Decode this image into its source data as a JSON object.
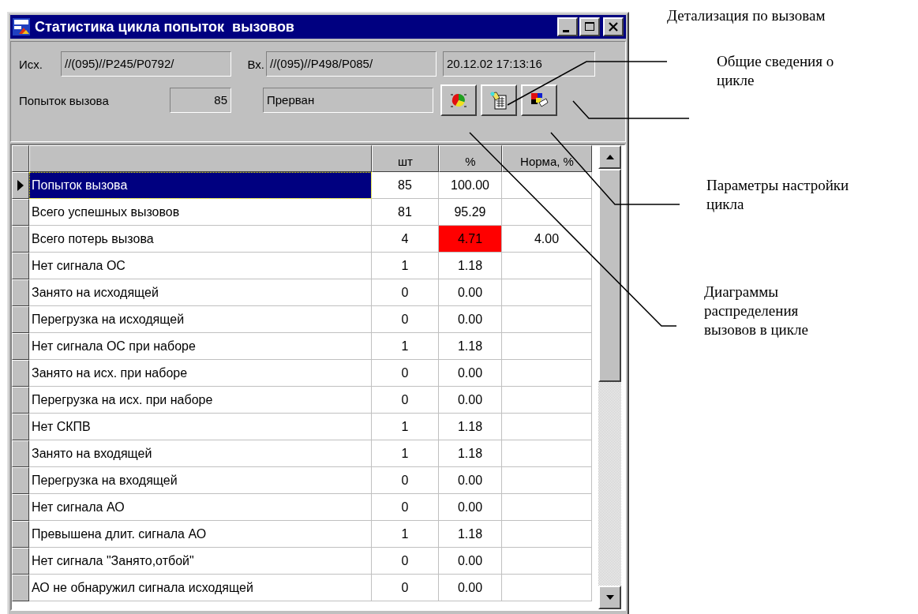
{
  "window": {
    "title": "Статистика цикла попыток  вызовов"
  },
  "header": {
    "outgoing_label": "Исх.",
    "outgoing": "//(095)//P245/P0792/",
    "incoming_label": "Вх.",
    "incoming": "//(095)//P498/P085/",
    "datetime": "20.12.02 17:13:16",
    "attempts_label": "Попыток вызова",
    "attempts": "85",
    "status": "Прерван"
  },
  "table": {
    "columns": [
      "шт",
      "%",
      "Норма, %"
    ],
    "rows": [
      {
        "name": "Попыток вызова",
        "count": "85",
        "percent": "100.00",
        "selected": true,
        "exceeded": false
      },
      {
        "name": "Всего успешных вызовов",
        "count": "81",
        "percent": "95.29",
        "selected": false,
        "exceeded": false
      },
      {
        "name": "Всего потерь вызова",
        "count": "4",
        "percent": "4.71",
        "norm": "4.00",
        "selected": false,
        "exceeded": true
      },
      {
        "name": "Нет сигнала ОС",
        "count": "1",
        "percent": "1.18",
        "selected": false,
        "exceeded": false
      },
      {
        "name": "Занято на исходящей",
        "count": "0",
        "percent": "0.00",
        "selected": false,
        "exceeded": false
      },
      {
        "name": "Перегрузка на исходящей",
        "count": "0",
        "percent": "0.00",
        "selected": false,
        "exceeded": false
      },
      {
        "name": "Нет сигнала ОС при наборе",
        "count": "1",
        "percent": "1.18",
        "selected": false,
        "exceeded": false
      },
      {
        "name": "Занято на исх. при наборе",
        "count": "0",
        "percent": "0.00",
        "selected": false,
        "exceeded": false
      },
      {
        "name": "Перегрузка на исх. при наборе",
        "count": "0",
        "percent": "0.00",
        "selected": false,
        "exceeded": false
      },
      {
        "name": "Нет СКПВ",
        "count": "1",
        "percent": "1.18",
        "selected": false,
        "exceeded": false
      },
      {
        "name": "Занято на входящей",
        "count": "1",
        "percent": "1.18",
        "selected": false,
        "exceeded": false
      },
      {
        "name": "Перегрузка на входящей",
        "count": "0",
        "percent": "0.00",
        "selected": false,
        "exceeded": false
      },
      {
        "name": "Нет сигнала АО",
        "count": "0",
        "percent": "0.00",
        "selected": false,
        "exceeded": false
      },
      {
        "name": "Превышена длит. сигнала АО",
        "count": "1",
        "percent": "1.18",
        "selected": false,
        "exceeded": false
      },
      {
        "name": "Нет сигнала \"Занято,отбой\"",
        "count": "0",
        "percent": "0.00",
        "selected": false,
        "exceeded": false
      },
      {
        "name": "АО не обнаружил сигнала исходящей",
        "count": "0",
        "percent": "0.00",
        "selected": false,
        "exceeded": false
      }
    ]
  },
  "callouts": [
    {
      "text": "Детализация по вызовам"
    },
    {
      "text": "Общие сведения о цикле"
    },
    {
      "text": "Параметры настройки цикла"
    },
    {
      "text": "Диаграммы распределения вызовов в цикле"
    }
  ]
}
